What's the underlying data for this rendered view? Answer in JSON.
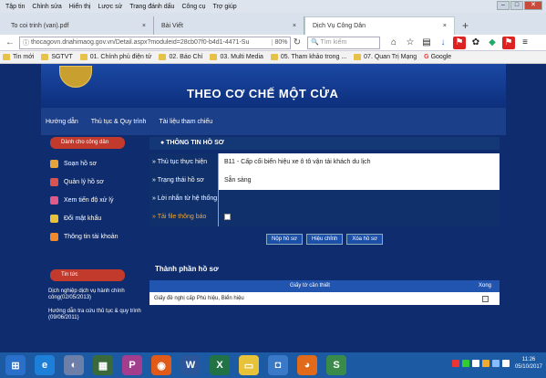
{
  "menu": [
    "Tập tin",
    "Chỉnh sửa",
    "Hiển thị",
    "Lược sử",
    "Trang đánh dấu",
    "Công cụ",
    "Trợ giúp"
  ],
  "tabs": [
    {
      "label": "To coi trinh (van).pdf"
    },
    {
      "label": "Bài Viết"
    },
    {
      "label": "Dịch Vụ Công Dân"
    }
  ],
  "navbar": {
    "url": "thocagovn.dnahimaog.gov.vn/Detail.aspx?moduleid=28cb07f0-b4d1-4471-Su",
    "zoom": "80%",
    "search_placeholder": "Tìm kiếm"
  },
  "bookmarks": [
    "Tin mới",
    "SGTVT",
    "01. Chính phủ điện tử",
    "02. Báo Chí",
    "03. Multi Media",
    "05. Tham khảo trong ...",
    "07. Quan Trị Mạng",
    "Google"
  ],
  "site": {
    "banner_title": "THEO CƠ CHẾ MỘT CỬA",
    "topnav": [
      "Hướng dẫn",
      "Thủ tục & Quy trình",
      "Tài liệu tham chiếu"
    ],
    "sidebar": {
      "head": "Dành cho công dân",
      "items": [
        "Soạn hồ sơ",
        "Quản lý hồ sơ",
        "Xem tiến độ xử lý",
        "Đổi mật khẩu",
        "Thông tin tài khoản"
      ],
      "news_head": "Tin tức",
      "news": [
        "Dịch nghiệp dịch vụ hành chính công(02/05/2013)",
        "Hướng dẫn tra cứu thủ tục & quy trình (09/06/2011)"
      ]
    },
    "info": {
      "title": "THÔNG TIN HỒ SƠ",
      "rows": [
        {
          "label": "» Thủ tục thực hiện",
          "value": "B11 - Cấp cổi biển hiệu xe ô tô vận tải khách du lịch"
        },
        {
          "label": "» Trạng thái hồ sơ",
          "value": "Sẵn sàng"
        },
        {
          "label": "» Lời nhắn từ hệ thống",
          "value": ""
        },
        {
          "label": "» Tải file thông báo",
          "value": ""
        }
      ],
      "buttons": [
        "Nộp hồ sơ",
        "Hiệu chỉnh",
        "Xóa hồ sơ"
      ]
    },
    "components": {
      "title": "Thành phần hồ sơ",
      "headers": [
        "Giấy tờ cần thiết",
        "Xong"
      ],
      "rows": [
        {
          "doc": "Giấy đề nghị cấp Phù hiệu, Biển hiệu"
        }
      ]
    }
  },
  "clock": {
    "time": "11:26",
    "date": "05/10/2017"
  }
}
